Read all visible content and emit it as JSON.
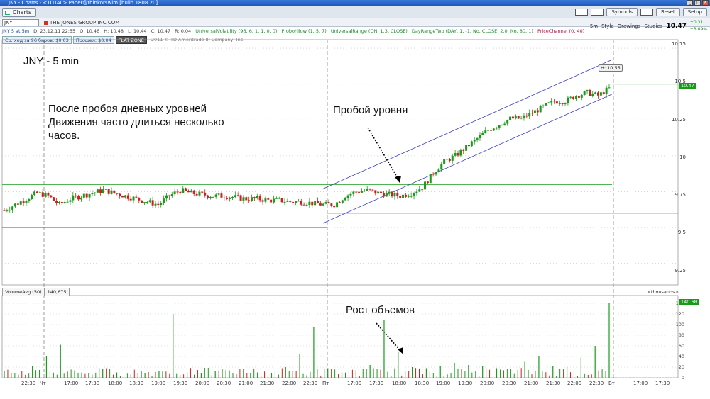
{
  "window": {
    "title": "JNY - Charts - <TOTAL> Paper@thinkorswim [build 1808.20]",
    "buttons": [
      "_",
      "□",
      "✕"
    ]
  },
  "toolbar": {
    "tab_label": "Charts",
    "right_buttons": [
      "Symbols",
      "Reset",
      "Setup"
    ]
  },
  "header": {
    "symbol": "JNY",
    "company": "THE JONES GROUP INC COM",
    "aggregation": "5m",
    "style_label": "Style",
    "drawings_label": "Drawings",
    "studies_label": "Studies",
    "last_price": "10.47",
    "change_top": "+0.31",
    "change_bottom": "+3.09%"
  },
  "study_line": [
    {
      "text": "JNY 5 at 5m",
      "color": "blue"
    },
    {
      "text": "D: 23.12.11 22:55",
      "color": "gray"
    },
    {
      "text": "O: 10.46",
      "color": "gray"
    },
    {
      "text": "H: 10.48",
      "color": "gray"
    },
    {
      "text": "L: 10.44",
      "color": "gray"
    },
    {
      "text": "C: 10.47",
      "color": "gray"
    },
    {
      "text": "R: 0.04",
      "color": "gray"
    },
    {
      "text": "UniversalVolatility (96, 6, 1, 1, 0, 0)",
      "color": "green"
    },
    {
      "text": "Probohilow (1, 5, 7)",
      "color": "green"
    },
    {
      "text": "UniversalRange (ON, 1.3, CLOSE)",
      "color": "green"
    },
    {
      "text": "DayRangeTwo (DAY, 1, -1, No, CLOSE, 2.0, No, 80, 1)",
      "color": "green"
    },
    {
      "text": "PriceChannel (0, 40)",
      "color": "red"
    }
  ],
  "stats": {
    "avg_move": "Ср. ход за 96 баров: $0.03",
    "passed": "Прошел: $0.04",
    "zone": "FLAT ZONE",
    "copyright": "2011 © TD Ameritrade IP Company, Inc."
  },
  "annotations": {
    "title": "JNY - 5 min",
    "body_lines": [
      "После пробоя дневных уровней",
      "Движения часто длиться несколько",
      "часов."
    ],
    "breakout": "Пробой уровня",
    "volume": "Рост объемов"
  },
  "price_axis": {
    "labels": [
      "10.75",
      "10.5",
      "10.25",
      "10",
      "9.75",
      "9.5",
      "9.25"
    ],
    "last_tag": "10.47",
    "high_badge": "H: 10.55"
  },
  "volume_panel": {
    "study": "VolumeAvg (50)",
    "value": "140,675",
    "units": "<thousands>",
    "labels": [
      "140",
      "120",
      "100",
      "80",
      "60",
      "40",
      "20",
      "0"
    ],
    "last_tag": "140.68"
  },
  "time_axis": [
    "22:30",
    "Чт",
    "17:00",
    "17:30",
    "18:00",
    "18:30",
    "19:00",
    "19:30",
    "20:00",
    "20:30",
    "21:00",
    "21:30",
    "22:00",
    "22:30",
    "Пт",
    "17:00",
    "17:30",
    "18:00",
    "18:30",
    "19:00",
    "19:30",
    "20:00",
    "20:30",
    "21:00",
    "21:30",
    "22:00",
    "22:30",
    "Вт",
    "17:00",
    "17:30"
  ],
  "colors": {
    "up": "#1a9a1a",
    "down": "#cc2020",
    "channel": "#3b3bc8",
    "level_green": "#3aa83a",
    "level_red": "#d42020"
  },
  "chart_data": {
    "type": "candlestick",
    "ylim": [
      9.1,
      10.78
    ],
    "day_levels": {
      "day1_high": 9.8,
      "day1_low": 9.5,
      "day2_high": 9.8,
      "day2_low": 9.6,
      "current": 10.5
    },
    "close_path": [
      9.62,
      9.66,
      9.7,
      9.74,
      9.72,
      9.66,
      9.7,
      9.72,
      9.74,
      9.76,
      9.74,
      9.72,
      9.7,
      9.68,
      9.66,
      9.72,
      9.76,
      9.74,
      9.73,
      9.72,
      9.72,
      9.71,
      9.7,
      9.7,
      9.69,
      9.69,
      9.68,
      9.68,
      9.67,
      9.66,
      9.66,
      9.72,
      9.75,
      9.76,
      9.74,
      9.73,
      9.72,
      9.74,
      9.78,
      9.88,
      9.96,
      10.0,
      10.06,
      10.12,
      10.18,
      10.22,
      10.26,
      10.26,
      10.3,
      10.34,
      10.38,
      10.38,
      10.42,
      10.44,
      10.42,
      10.47
    ],
    "volume_thousands": [
      12,
      6,
      22,
      40,
      62,
      14,
      8,
      16,
      10,
      6,
      8,
      12,
      120,
      10,
      8,
      12,
      14,
      16,
      10,
      8,
      20,
      44,
      95,
      18,
      10,
      14,
      24,
      108,
      48,
      20,
      18,
      22,
      28,
      24,
      22,
      18,
      16,
      30,
      40,
      22,
      20,
      38,
      60,
      140
    ]
  }
}
